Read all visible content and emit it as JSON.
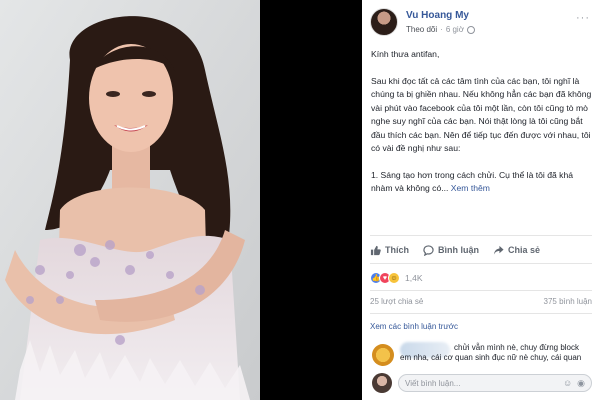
{
  "post": {
    "author": "Vu Hoang My",
    "follow": "Theo dõi",
    "time": "6 giờ",
    "paragraphs": [
      "Kính thưa antifan,",
      "Sau khi đọc tất cả các tâm tình của các bạn, tôi nghĩ là chúng ta bị ghiền nhau. Nếu không hẳn các bạn đã không vài phút vào facebook của tôi một lần, còn tôi cũng tò mò nghe suy nghĩ của các bạn. Nói thật lòng là tôi cũng bắt đầu thích các bạn. Nên để tiếp tục đến được với nhau, tôi có vài đề nghị như sau:",
      "1. Sáng tạo hơn trong cách chửi. Cụ thể là tôi đã khá nhàm và không có..."
    ],
    "see_more": "Xem thêm"
  },
  "actions": {
    "like": "Thích",
    "comment": "Bình luận",
    "share": "Chia sẻ"
  },
  "reactions": {
    "count": "1,4K"
  },
  "stats": {
    "shares": "25 lượt chia sẻ",
    "comments": "375 bình luận"
  },
  "comments": {
    "view_previous": "Xem các bình luận trước",
    "items": [
      {
        "text": "chửi vẫn mình nè, chuy đừng block em nha, cái cơ quan sinh đục nữ nè chuy, cái quan"
      }
    ]
  },
  "compose": {
    "placeholder": "Viết bình luận..."
  },
  "colors": {
    "link": "#365899",
    "like_blue": "#4a7ff0",
    "love_red": "#f0445c",
    "haha_yellow": "#f7c33b"
  }
}
